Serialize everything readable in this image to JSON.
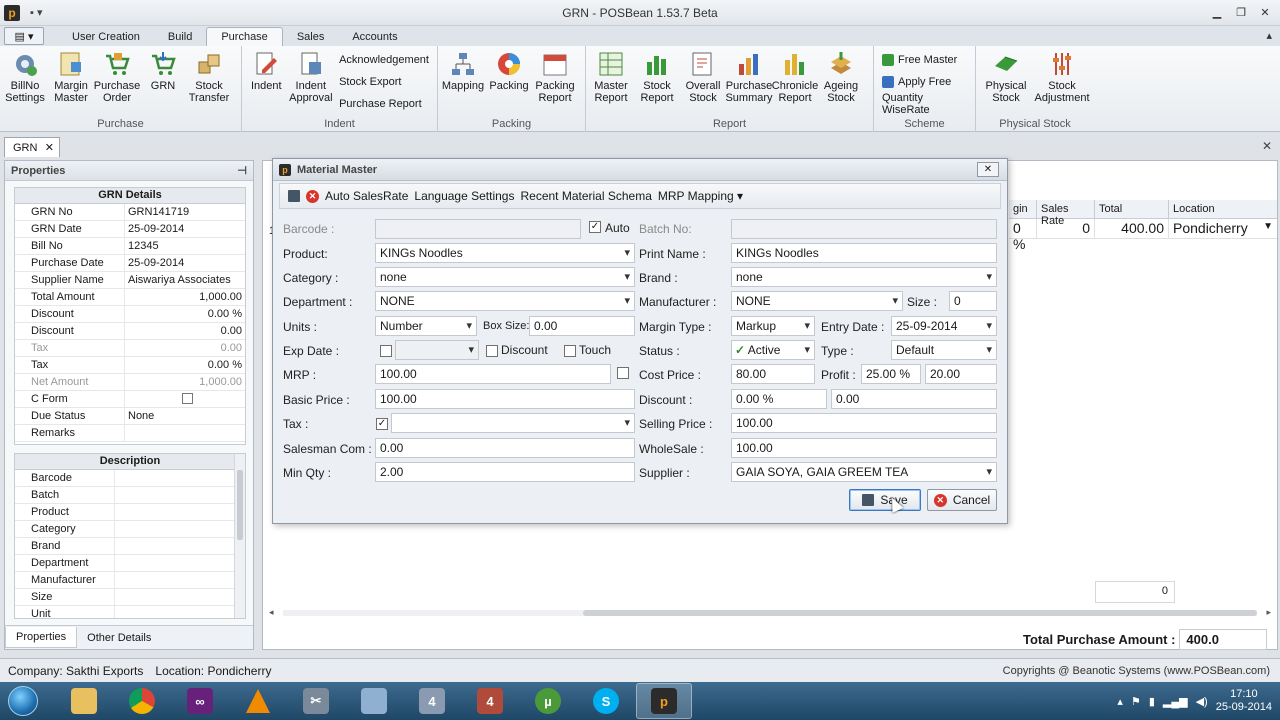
{
  "window": {
    "title": "GRN - POSBean 1.53.7 Beta"
  },
  "ribbon_tabs": [
    "User Creation",
    "Build",
    "Purchase",
    "Sales",
    "Accounts"
  ],
  "ribbon": {
    "purchase_group": {
      "label": "Purchase",
      "buttons": [
        "BillNo Settings",
        "Margin Master",
        "Purchase Order",
        "GRN",
        "Stock Transfer"
      ]
    },
    "indent_group": {
      "label": "Indent",
      "buttons": [
        "Indent",
        "Indent Approval"
      ],
      "small": [
        "Acknowledgement",
        "Stock Export",
        "Purchase Report"
      ]
    },
    "packing_group": {
      "label": "Packing",
      "buttons": [
        "Mapping",
        "Packing",
        "Packing Report"
      ]
    },
    "report_group": {
      "label": "Report",
      "buttons": [
        "Master Report",
        "Stock Report",
        "Overall Stock",
        "Purchase Summary",
        "Chronicle Report",
        "Ageing Stock"
      ]
    },
    "scheme_group": {
      "label": "Scheme",
      "small": [
        "Free Master",
        "Apply Free",
        "Quantity WiseRate"
      ]
    },
    "physical_group": {
      "label": "Physical Stock",
      "buttons": [
        "Physical Stock",
        "Stock Adjustment"
      ]
    }
  },
  "doc_tab": {
    "label": "GRN"
  },
  "properties": {
    "title": "Properties",
    "grn_details_title": "GRN Details",
    "rows": [
      {
        "k": "GRN No",
        "v": "GRN141719"
      },
      {
        "k": "GRN Date",
        "v": "25-09-2014"
      },
      {
        "k": "Bill No",
        "v": "12345"
      },
      {
        "k": "Purchase Date",
        "v": "25-09-2014"
      },
      {
        "k": "Supplier Name",
        "v": "Aiswariya Associates"
      },
      {
        "k": "Total Amount",
        "v": "1,000.00"
      },
      {
        "k": "Discount",
        "v": "0.00 %"
      },
      {
        "k": "Discount",
        "v": "0.00"
      },
      {
        "k": "Tax",
        "v": "0.00"
      },
      {
        "k": "Tax",
        "v": "0.00 %"
      },
      {
        "k": "Net Amount",
        "v": "1,000.00"
      },
      {
        "k": "C Form",
        "v": ""
      },
      {
        "k": "Due Status",
        "v": "None"
      },
      {
        "k": "Remarks",
        "v": ""
      }
    ],
    "description_title": "Description",
    "desc_rows": [
      "Barcode",
      "Batch",
      "Product",
      "Category",
      "Brand",
      "Department",
      "Manufacturer",
      "Size",
      "Unit"
    ],
    "tabs": [
      "Properties",
      "Other Details"
    ]
  },
  "main_grid": {
    "headers": [
      "gin",
      "Sales Rate",
      "Total",
      "Location"
    ],
    "row": {
      "gin": "0 %",
      "sales_rate": "0",
      "total": "400.00",
      "location": "Pondicherry"
    },
    "row_prefix": "1",
    "total_box": "0",
    "total_purchase_label": "Total Purchase Amount :",
    "total_purchase_value": "400.0"
  },
  "dialog": {
    "title": "Material Master",
    "toolbar": [
      "Auto SalesRate",
      "Language Settings",
      "Recent Material Schema",
      "MRP Mapping"
    ],
    "labels": {
      "barcode": "Barcode :",
      "auto": "Auto",
      "batch_no": "Batch No:",
      "product": "Product:",
      "print_name": "Print Name :",
      "category": "Category :",
      "brand": "Brand :",
      "department": "Department :",
      "manufacturer": "Manufacturer :",
      "size": "Size :",
      "units": "Units :",
      "box_size": "Box Size:",
      "margin_type": "Margin Type :",
      "entry_date": "Entry Date :",
      "exp_date": "Exp Date :",
      "discount_chk": "Discount",
      "touch_chk": "Touch",
      "status": "Status :",
      "type": "Type :",
      "mrp": "MRP :",
      "cost_price": "Cost Price :",
      "profit": "Profit :",
      "basic_price": "Basic Price :",
      "discount": "Discount :",
      "tax": "Tax :",
      "selling_price": "Selling Price :",
      "salesman_com": "Salesman Com :",
      "wholesale": "WholeSale :",
      "min_qty": "Min Qty :",
      "supplier": "Supplier :"
    },
    "values": {
      "product": "KINGs Noodles",
      "print_name": "KINGs Noodles",
      "category": "none",
      "brand": "none",
      "department": "NONE",
      "manufacturer": "NONE",
      "size": "0",
      "units": "Number",
      "box_size": "0.00",
      "margin_type": "Markup",
      "entry_date": "25-09-2014",
      "status": "Active",
      "type": "Default",
      "mrp": "100.00",
      "cost_price": "80.00",
      "profit_pct": "25.00 %",
      "profit_val": "20.00",
      "basic_price": "100.00",
      "discount_pct": "0.00 %",
      "discount_val": "0.00",
      "selling_price": "100.00",
      "salesman_com": "0.00",
      "wholesale": "100.00",
      "min_qty": "2.00",
      "supplier": "GAIA SOYA, GAIA GREEM TEA"
    },
    "save_label": "Save",
    "cancel_label": "Cancel"
  },
  "statusbar": {
    "company": "Company: Sakthi Exports",
    "location": "Location: Pondicherry",
    "copyright": "Copyrights @ Beanotic Systems (www.POSBean.com)"
  },
  "taskbar": {
    "time": "17:10",
    "date": "25-09-2014"
  }
}
